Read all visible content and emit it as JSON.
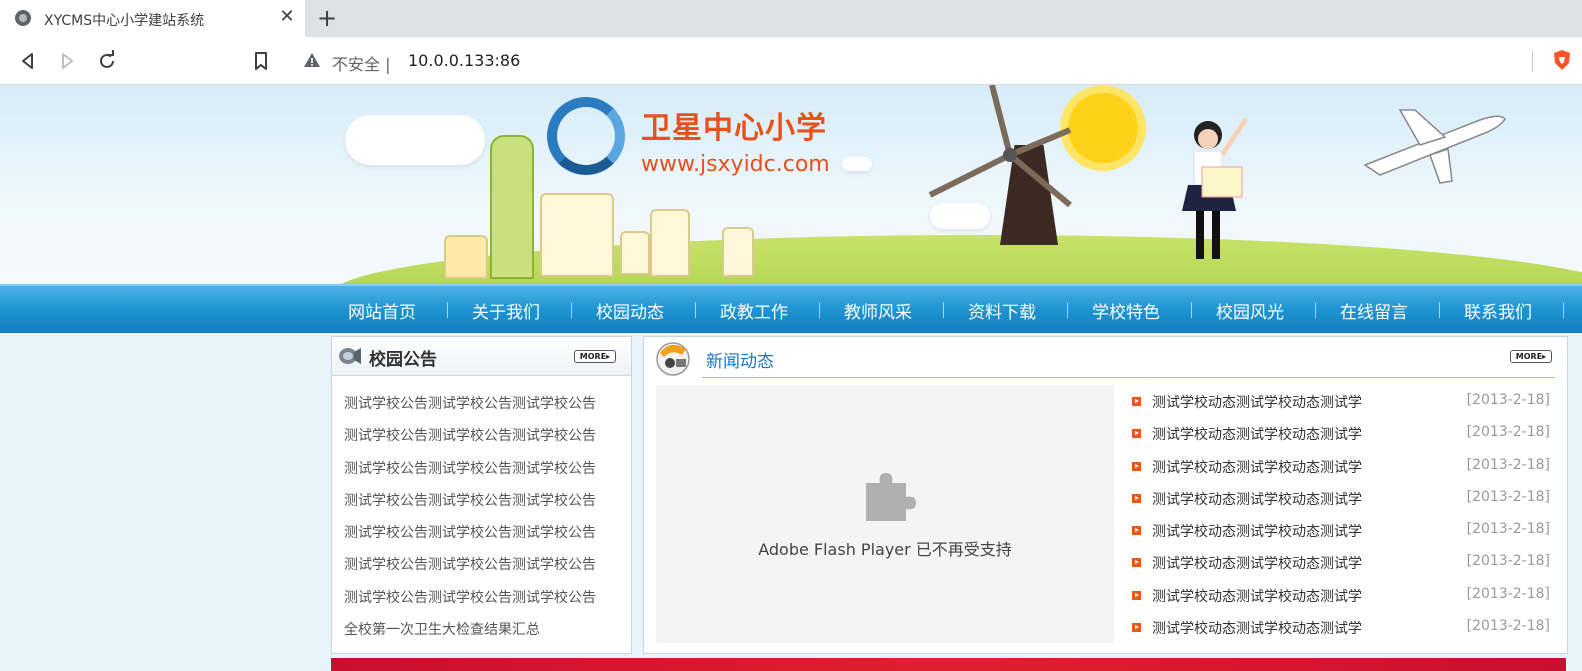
{
  "browser": {
    "tab": {
      "title": "XYCMS中心小学建站系统",
      "close": "✕"
    },
    "new_tab": "+",
    "address": {
      "security": "不安全 |",
      "url": "10.0.0.133:86"
    }
  },
  "banner": {
    "site_name": "卫星中心小学",
    "site_url": "www.jsxyidc.com"
  },
  "nav": {
    "items": [
      "网站首页",
      "关于我们",
      "校园动态",
      "政教工作",
      "教师风采",
      "资料下载",
      "学校特色",
      "校园风光",
      "在线留言",
      "联系我们"
    ]
  },
  "notice": {
    "title": "校园公告",
    "more": "MORE▸",
    "items": [
      "测试学校公告测试学校公告测试学校公告",
      "测试学校公告测试学校公告测试学校公告",
      "测试学校公告测试学校公告测试学校公告",
      "测试学校公告测试学校公告测试学校公告",
      "测试学校公告测试学校公告测试学校公告",
      "测试学校公告测试学校公告测试学校公告",
      "测试学校公告测试学校公告测试学校公告",
      "全校第一次卫生大检查结果汇总"
    ]
  },
  "news": {
    "title": "新闻动态",
    "more": "MORE▸",
    "flash_message": "Adobe Flash Player 已不再受支持",
    "items": [
      {
        "title": "测试学校动态测试学校动态测试学",
        "date": "[2013-2-18]"
      },
      {
        "title": "测试学校动态测试学校动态测试学",
        "date": "[2013-2-18]"
      },
      {
        "title": "测试学校动态测试学校动态测试学",
        "date": "[2013-2-18]"
      },
      {
        "title": "测试学校动态测试学校动态测试学",
        "date": "[2013-2-18]"
      },
      {
        "title": "测试学校动态测试学校动态测试学",
        "date": "[2013-2-18]"
      },
      {
        "title": "测试学校动态测试学校动态测试学",
        "date": "[2013-2-18]"
      },
      {
        "title": "测试学校动态测试学校动态测试学",
        "date": "[2013-2-18]"
      },
      {
        "title": "测试学校动态测试学校动态测试学",
        "date": "[2013-2-18]"
      }
    ]
  },
  "colors": {
    "nav_blue": "#1f94d2",
    "accent_orange": "#e8501c",
    "news_title_blue": "#1b76c6",
    "bullet_orange": "#e55a1a"
  }
}
